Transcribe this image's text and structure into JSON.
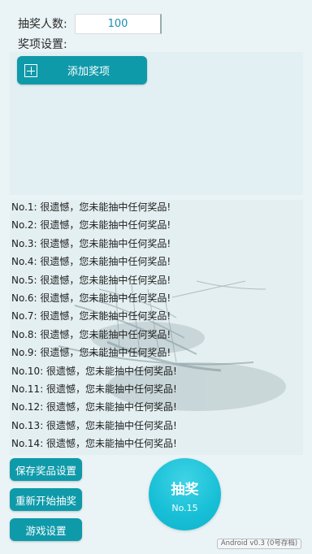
{
  "header": {
    "count_label": "抽奖人数:",
    "count_value": "100",
    "prize_settings_label": "奖项设置:"
  },
  "prize_panel": {
    "add_button_label": "添加奖项",
    "add_icon": "plus-square-icon"
  },
  "results": [
    "No.1: 很遗憾，您未能抽中任何奖品!",
    "No.2: 很遗憾，您未能抽中任何奖品!",
    "No.3: 很遗憾，您未能抽中任何奖品!",
    "No.4: 很遗憾，您未能抽中任何奖品!",
    "No.5: 很遗憾，您未能抽中任何奖品!",
    "No.6: 很遗憾，您未能抽中任何奖品!",
    "No.7: 很遗憾，您未能抽中任何奖品!",
    "No.8: 很遗憾，您未能抽中任何奖品!",
    "No.9: 很遗憾，您未能抽中任何奖品!",
    "No.10: 很遗憾，您未能抽中任何奖品!",
    "No.11: 很遗憾，您未能抽中任何奖品!",
    "No.12: 很遗憾，您未能抽中任何奖品!",
    "No.13: 很遗憾，您未能抽中任何奖品!",
    "No.14: 很遗憾，您未能抽中任何奖品!"
  ],
  "buttons": {
    "save": "保存奖品设置",
    "restart": "重新开始抽奖",
    "settings": "游戏设置",
    "draw_main": "抽奖",
    "draw_sub": "No.15"
  },
  "version": "Android v0.3 (0号存档)",
  "colors": {
    "accent": "#0f9aaa",
    "draw_button": "#17bfd6",
    "background": "#eaf3f5"
  }
}
